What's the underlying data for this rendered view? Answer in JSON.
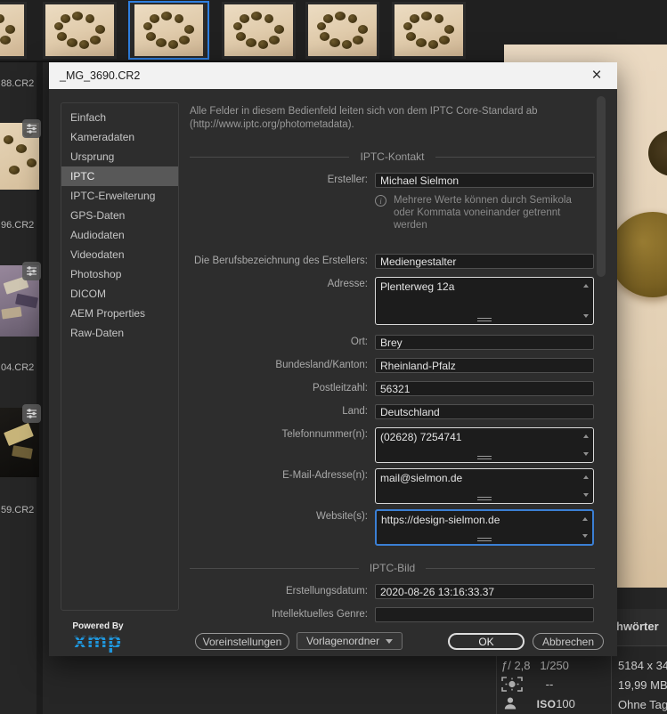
{
  "browser": {
    "left_filenames": [
      "88.CR2",
      "96.CR2",
      "04.CR2",
      "59.CR2"
    ],
    "keywords_tab_partial": "hwörter",
    "camera": {
      "aperture": "ƒ/ 2,8",
      "shutter": "1/250",
      "metering_value": "--",
      "iso_label": "ISO",
      "iso_value": "100"
    },
    "file_info": [
      "5184 x 34",
      "19,99 MB",
      "Ohne Tag"
    ]
  },
  "dialog": {
    "title": "_MG_3690.CR2",
    "close_label": "×",
    "sidebar_selected": "IPTC",
    "sidebar_items": [
      "Einfach",
      "Kameradaten",
      "Ursprung",
      "IPTC",
      "IPTC-Erweiterung",
      "GPS-Daten",
      "Audiodaten",
      "Videodaten",
      "Photoshop",
      "DICOM",
      "AEM Properties",
      "Raw-Daten"
    ],
    "intro": "Alle Felder in diesem Bedienfeld leiten sich von dem IPTC Core-Standard ab (http://www.iptc.org/photometadata).",
    "sections": {
      "contact": "IPTC-Kontakt",
      "image": "IPTC-Bild"
    },
    "hint": "Mehrere Werte können durch Semikola oder Kommata voneinander getrennt werden",
    "fields": {
      "ersteller": {
        "label": "Ersteller:",
        "value": "Michael Sielmon"
      },
      "beruf": {
        "label": "Die Berufsbezeichnung des Erstellers:",
        "value": "Mediengestalter"
      },
      "adresse": {
        "label": "Adresse:",
        "value": "Plenterweg 12a"
      },
      "ort": {
        "label": "Ort:",
        "value": "Brey"
      },
      "bundesland": {
        "label": "Bundesland/Kanton:",
        "value": "Rheinland-Pfalz"
      },
      "plz": {
        "label": "Postleitzahl:",
        "value": "56321"
      },
      "land": {
        "label": "Land:",
        "value": "Deutschland"
      },
      "telefon": {
        "label": "Telefonnummer(n):",
        "value": "(02628) 7254741"
      },
      "email": {
        "label": "E-Mail-Adresse(n):",
        "value": "mail@sielmon.de"
      },
      "website": {
        "label": "Website(s):",
        "value": "https://design-sielmon.de"
      },
      "datum": {
        "label": "Erstellungsdatum:",
        "value": "2020-08-26 13:16:33.37"
      },
      "genre": {
        "label": "Intellektuelles Genre:",
        "value": ""
      }
    },
    "footer": {
      "powered_by": "Powered By",
      "xmp_logo": "xmp",
      "presets_button": "Voreinstellungen",
      "template_dropdown": "Vorlagenordner",
      "ok_button": "OK",
      "cancel_button": "Abbrechen",
      "accent_blue": "#1f96dc",
      "focus_border": "#3b7fd4"
    }
  }
}
